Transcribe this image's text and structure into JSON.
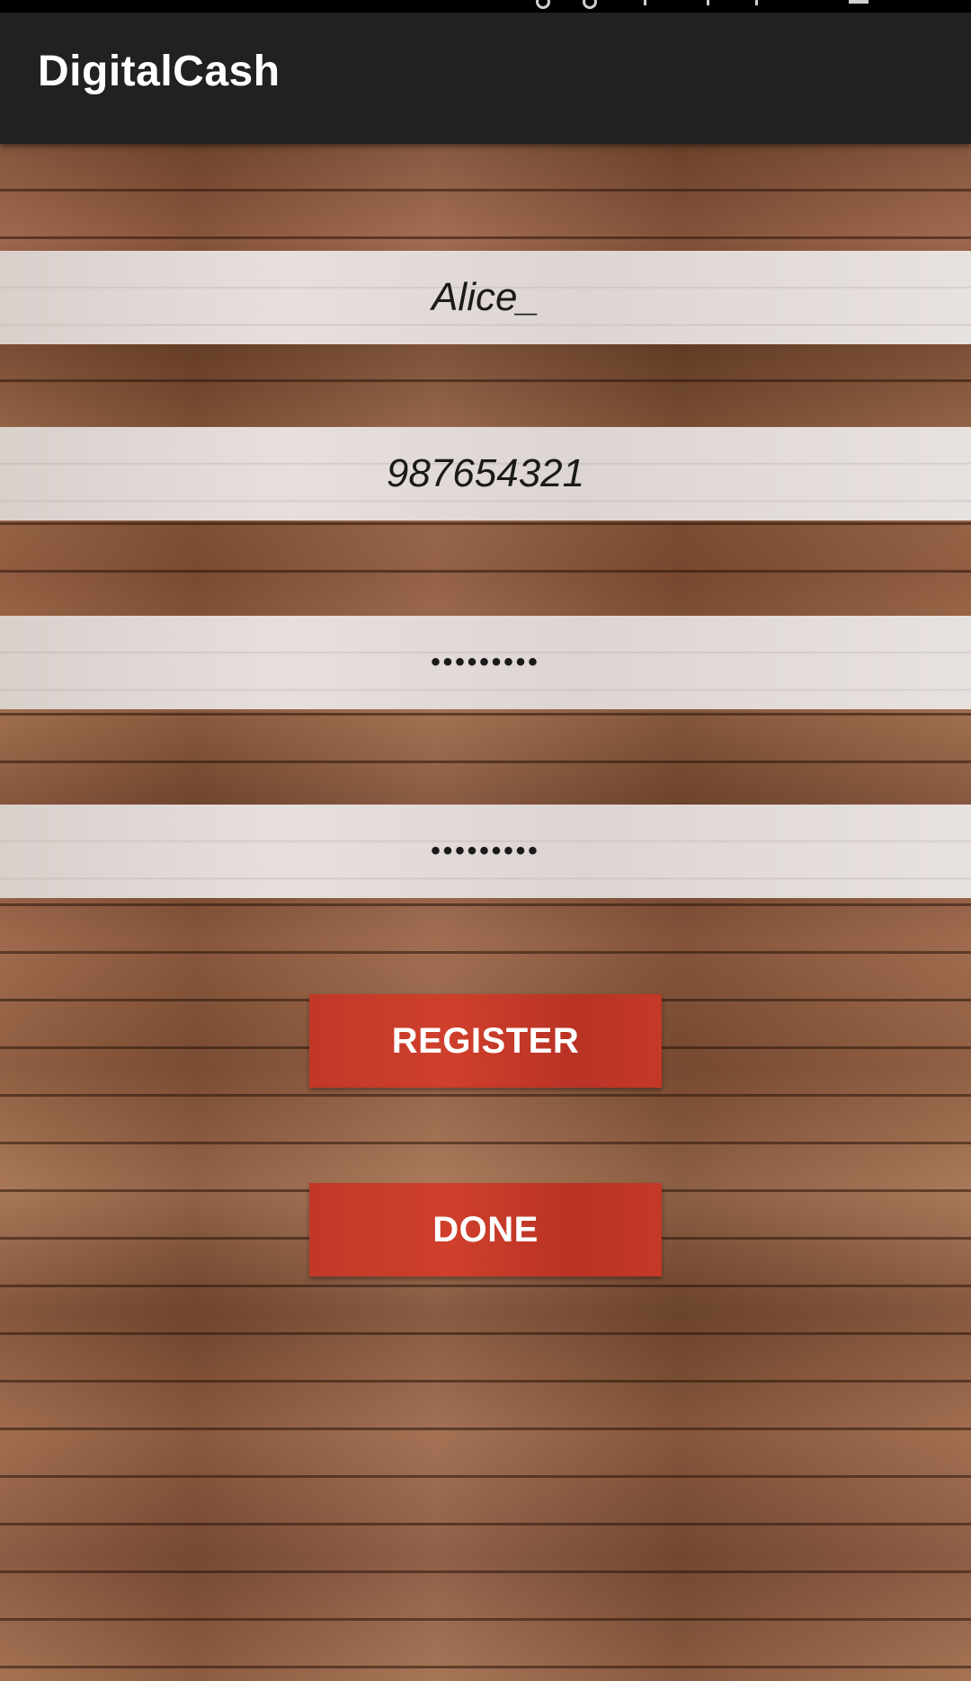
{
  "app": {
    "title": "DigitalCash"
  },
  "form": {
    "username": {
      "value": "Alice_"
    },
    "phone": {
      "value": "987654321"
    },
    "password": {
      "value": "•••••••••"
    },
    "confirm_password": {
      "value": "•••••••••"
    }
  },
  "buttons": {
    "register_label": "REGISTER",
    "done_label": "DONE"
  },
  "colors": {
    "app_bar": "#212121",
    "status_bar": "#000000",
    "button": "#c43828",
    "button_text": "#ffffff",
    "field_bg": "#e3dcd9",
    "wood": "#8a5638"
  }
}
